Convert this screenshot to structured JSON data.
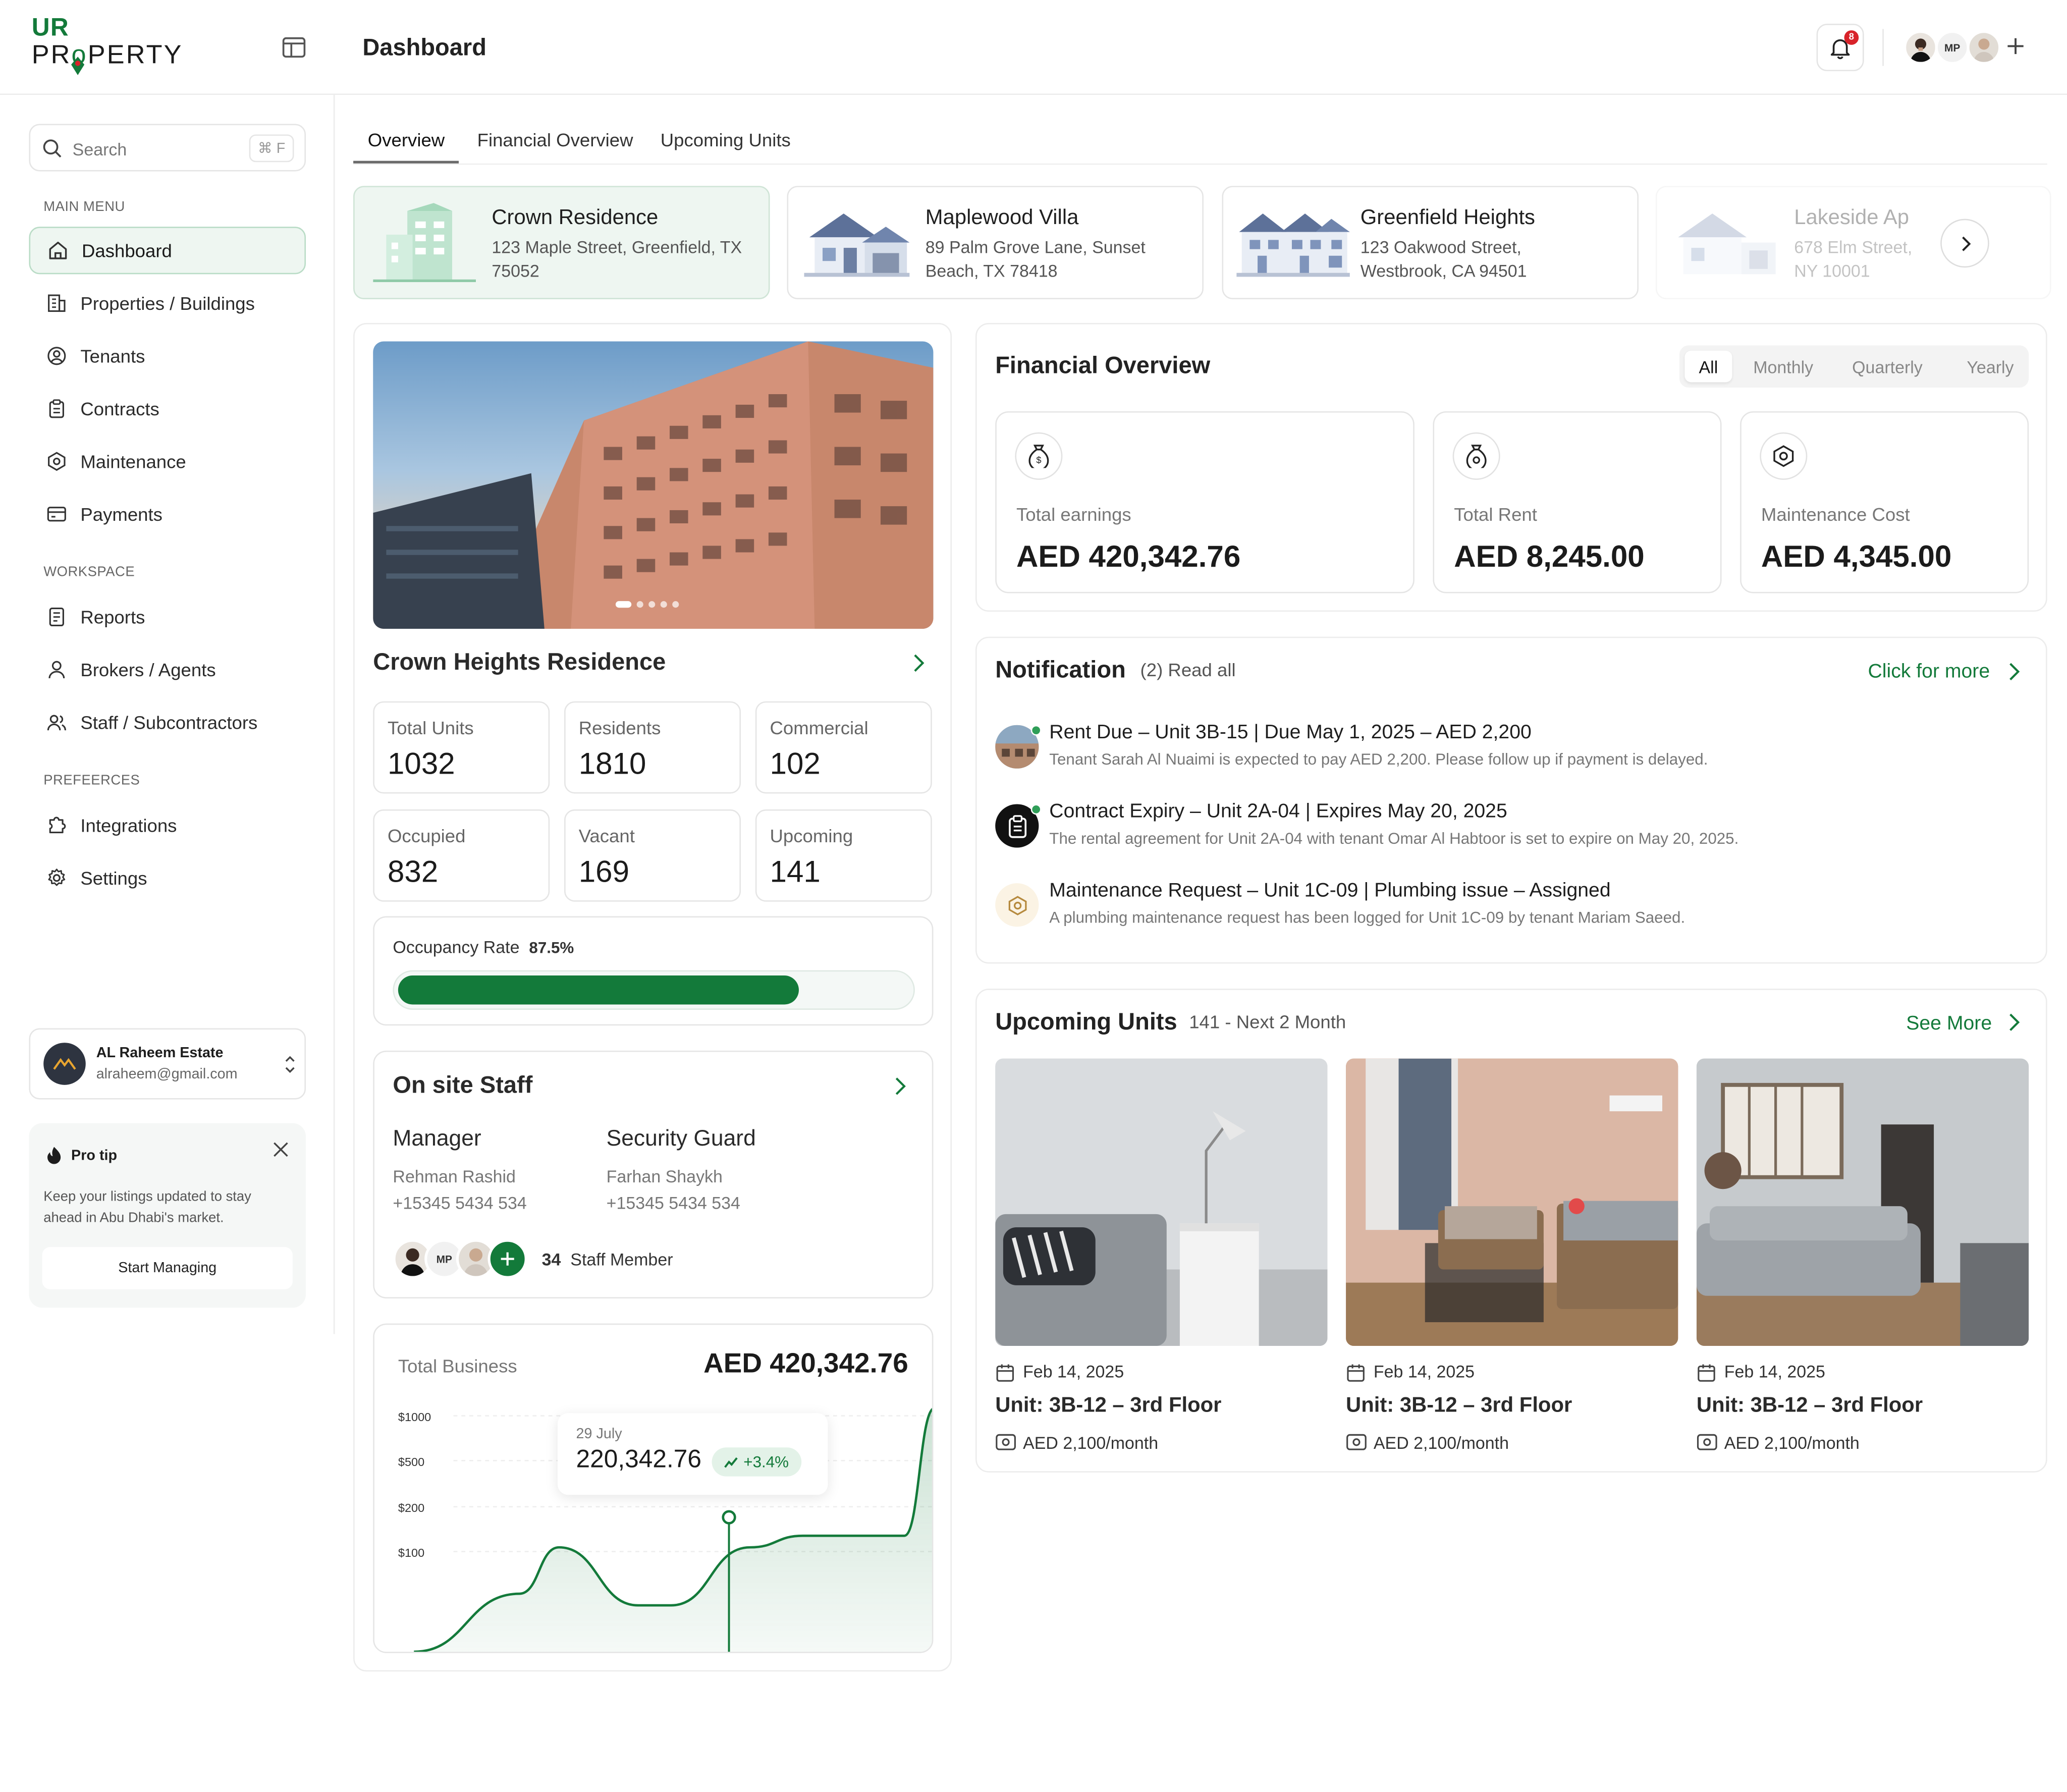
{
  "brand": {
    "line1": "UR",
    "line2": "PR",
    "line2b": "PERTY",
    "accent": "#137a3a"
  },
  "header": {
    "title": "Dashboard",
    "notif_count": "8",
    "avatar_initials": "MP"
  },
  "sidebar": {
    "search_placeholder": "Search",
    "search_shortcut": "⌘ F",
    "main_menu_label": "MAIN MENU",
    "main_items": [
      {
        "label": "Dashboard",
        "icon": "home-icon"
      },
      {
        "label": "Properties / Buildings",
        "icon": "building-icon"
      },
      {
        "label": "Tenants",
        "icon": "user-circle-icon"
      },
      {
        "label": "Contracts",
        "icon": "clipboard-icon"
      },
      {
        "label": "Maintenance",
        "icon": "hex-gear-icon"
      },
      {
        "label": "Payments",
        "icon": "card-icon"
      }
    ],
    "workspace_label": "WORKSPACE",
    "workspace_items": [
      {
        "label": "Reports",
        "icon": "report-icon"
      },
      {
        "label": "Brokers / Agents",
        "icon": "user-icon"
      },
      {
        "label": "Staff / Subcontractors",
        "icon": "users-icon"
      }
    ],
    "prefs_label": "PREFEERCES",
    "pref_items": [
      {
        "label": "Integrations",
        "icon": "puzzle-icon"
      },
      {
        "label": "Settings",
        "icon": "gear-icon"
      }
    ],
    "account": {
      "name": "AL Raheem Estate",
      "email": "alraheem@gmail.com"
    },
    "tip": {
      "title": "Pro tip",
      "text": "Keep your listings updated to stay ahead in Abu Dhabi's market.",
      "button": "Start Managing"
    }
  },
  "tabs": [
    "Overview",
    "Financial Overview",
    "Upcoming Units"
  ],
  "properties": [
    {
      "name": "Crown Residence",
      "address": "123 Maple Street, Greenfield, TX 75052"
    },
    {
      "name": "Maplewood Villa",
      "address": "89 Palm Grove Lane, Sunset Beach, TX 78418"
    },
    {
      "name": "Greenfield Heights",
      "address": "123 Oakwood Street, Westbrook, CA 94501"
    },
    {
      "name": "Lakeside Ap",
      "address": "678 Elm Street, NY 10001"
    }
  ],
  "building": {
    "name": "Crown Heights Residence",
    "stats": [
      {
        "label": "Total Units",
        "value": "1032"
      },
      {
        "label": "Residents",
        "value": "1810"
      },
      {
        "label": "Commercial",
        "value": "102"
      },
      {
        "label": "Occupied",
        "value": "832"
      },
      {
        "label": "Vacant",
        "value": "169"
      },
      {
        "label": "Upcoming",
        "value": "141"
      }
    ],
    "occupancy_label": "Occupancy Rate",
    "occupancy_value": "87.5%",
    "occupancy_fraction": 0.78
  },
  "staff": {
    "title": "On site Staff",
    "roles": [
      {
        "role": "Manager",
        "name": "Rehman Rashid",
        "phone": "+15345 5434 534"
      },
      {
        "role": "Security Guard",
        "name": "Farhan Shaykh",
        "phone": "+15345 5434 534"
      }
    ],
    "count": "34",
    "count_label": "Staff Member",
    "avatar_initials": "MP"
  },
  "business": {
    "label": "Total Business",
    "total": "AED 420,342.76",
    "tooltip_date": "29 July",
    "tooltip_value": "220,342.76",
    "tooltip_change": "+3.4%"
  },
  "chart_data": {
    "type": "area",
    "y_tick_labels": [
      "$1000",
      "$500",
      "$200",
      "$100"
    ],
    "series": [
      {
        "values": [
          0,
          100,
          180,
          80,
          80,
          180,
          200,
          200,
          420
        ]
      }
    ]
  },
  "financial": {
    "title": "Financial Overview",
    "periods": [
      "All",
      "Monthly",
      "Quarterly",
      "Yearly"
    ],
    "cards": [
      {
        "label": "Total earnings",
        "value": "AED 420,342.76"
      },
      {
        "label": "Total Rent",
        "value": "AED 8,245.00"
      },
      {
        "label": "Maintenance Cost",
        "value": "AED 4,345.00"
      }
    ]
  },
  "notifications": {
    "title": "Notification",
    "read_all": "(2) Read all",
    "more": "Click for more",
    "items": [
      {
        "title": "Rent Due – Unit 3B-15 | Due May 1, 2025 – AED 2,200",
        "desc": "Tenant Sarah Al Nuaimi is expected to pay AED 2,200. Please follow up if payment is delayed."
      },
      {
        "title": "Contract Expiry – Unit 2A-04 | Expires May 20, 2025",
        "desc": "The rental agreement for Unit 2A-04 with tenant Omar Al Habtoor is set to expire on May 20, 2025."
      },
      {
        "title": "Maintenance Request – Unit 1C-09 | Plumbing issue – Assigned",
        "desc": "A plumbing maintenance request has been logged for Unit 1C-09 by tenant Mariam Saeed."
      }
    ]
  },
  "upcoming": {
    "title": "Upcoming Units",
    "subtitle": "141 - Next 2 Month",
    "more": "See More",
    "units": [
      {
        "date": "Feb 14, 2025",
        "name": "Unit: 3B-12 – 3rd Floor",
        "price": "AED 2,100/month"
      },
      {
        "date": "Feb 14, 2025",
        "name": "Unit: 3B-12 – 3rd Floor",
        "price": "AED 2,100/month"
      },
      {
        "date": "Feb 14, 2025",
        "name": "Unit: 3B-12 – 3rd Floor",
        "price": "AED 2,100/month"
      }
    ]
  }
}
